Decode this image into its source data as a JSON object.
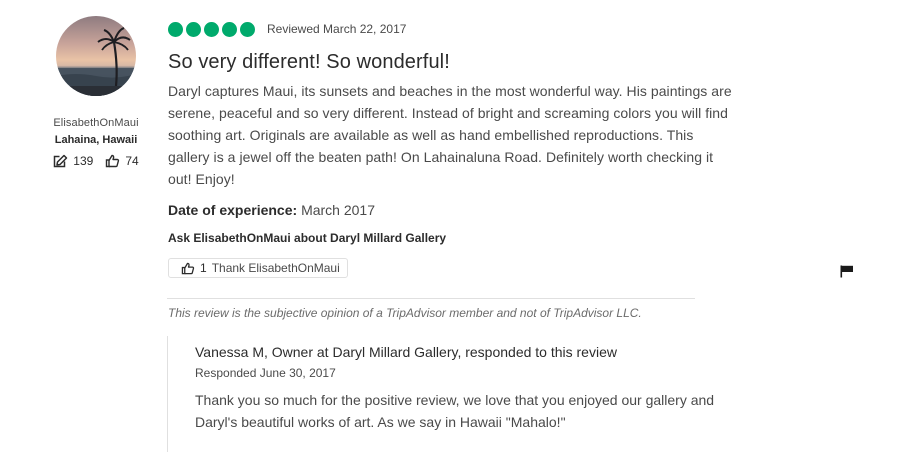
{
  "reviewer": {
    "username": "ElisabethOnMaui",
    "location": "Lahaina, Hawaii",
    "contributions": "139",
    "helpful_votes": "74",
    "icons": {
      "contributions": "pencil-edit-icon",
      "helpful": "thumbs-up-icon"
    }
  },
  "review": {
    "rating": 5,
    "rating_max": 5,
    "bubble_color": "#00aa6c",
    "date": "Reviewed March 22, 2017",
    "title": "So very different! So wonderful!",
    "text_lines": [
      "Daryl captures Maui, its sunsets and beaches in the most wonderful way. His paintings are",
      "serene, peaceful and so very different. Instead of bright and screaming colors you will find",
      "soothing art. Originals are available as well as hand embellished reproductions. This",
      "gallery is a jewel off the beaten path! On Lahainaluna Road. Definitely worth checking it",
      "out! Enjoy!"
    ],
    "experience_label": "Date of experience:",
    "experience_value": "March 2017",
    "ask_link": "Ask ElisabethOnMaui about Daryl Millard Gallery",
    "thank_count": "1",
    "thank_label": "Thank ElisabethOnMaui",
    "flag_icon": "flag-icon"
  },
  "disclaimer": "This review is the subjective opinion of a TripAdvisor member and not of TripAdvisor LLC.",
  "owner_response": {
    "author": "Vanessa M, Owner at Daryl Millard Gallery, responded to this review",
    "date": "Responded June 30, 2017",
    "text_lines": [
      "Thank you so much for the positive review, we love that you enjoyed our gallery and",
      "Daryl's beautiful works of art. As we say in Hawaii \"Mahalo!\""
    ]
  }
}
